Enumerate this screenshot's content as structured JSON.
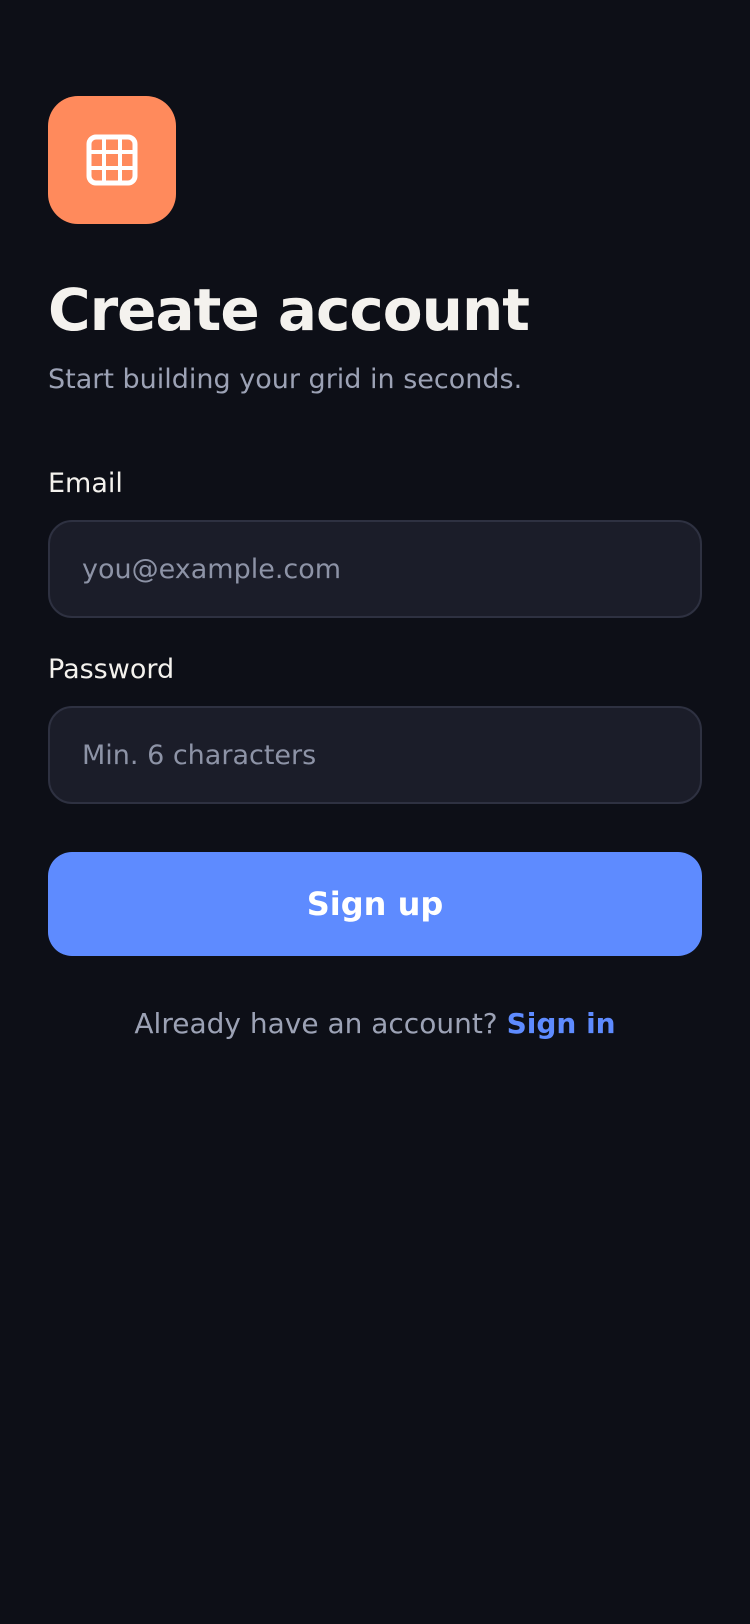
{
  "logo": {
    "icon": "grid-icon",
    "color": "#ff8a5c"
  },
  "header": {
    "title": "Create account",
    "subtitle": "Start building your grid in seconds."
  },
  "form": {
    "email": {
      "label": "Email",
      "value": "",
      "placeholder": "you@example.com"
    },
    "password": {
      "label": "Password",
      "value": "",
      "placeholder": "Min. 6 characters"
    },
    "submit_label": "Sign up"
  },
  "footer": {
    "prompt": "Already have an account?",
    "link_label": "Sign in"
  },
  "colors": {
    "background": "#0d0f17",
    "accent": "#5e8bff",
    "brand": "#ff8a5c"
  }
}
